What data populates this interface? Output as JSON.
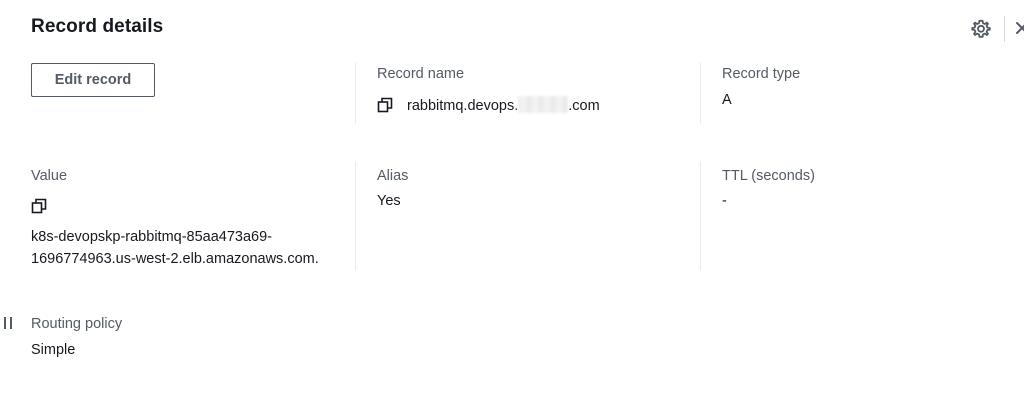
{
  "panel": {
    "title": "Record details",
    "settings_icon": "gear-icon",
    "close_icon": "close-icon"
  },
  "actions": {
    "edit_label": "Edit record"
  },
  "fields": {
    "record_name": {
      "label": "Record name",
      "value_prefix": "rabbitmq.devops.",
      "value_suffix": ".com",
      "icon": "copy-icon"
    },
    "record_type": {
      "label": "Record type",
      "value": "A"
    },
    "value": {
      "label": "Value",
      "line1": "k8s-devopskp-rabbitmq-85aa473a69-",
      "line2": "1696774963.us-west-2.elb.amazonaws.com.",
      "icon": "copy-icon"
    },
    "alias": {
      "label": "Alias",
      "value": "Yes"
    },
    "ttl": {
      "label": "TTL (seconds)",
      "value": "-"
    },
    "routing_policy": {
      "label": "Routing policy",
      "value": "Simple"
    }
  },
  "colors": {
    "text_primary": "#16191f",
    "text_secondary": "#545b64",
    "divider": "#eaeded"
  }
}
